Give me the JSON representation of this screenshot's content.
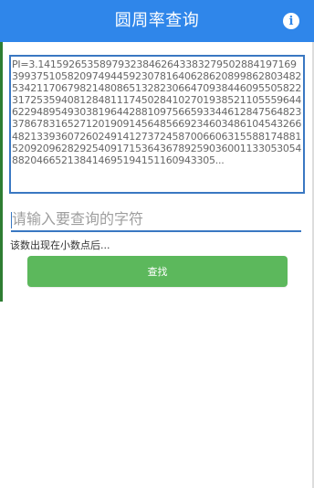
{
  "app_bar": {
    "title": "圆周率查询",
    "info_icon": "info-icon",
    "info_glyph": "i",
    "color": "#2f86ea"
  },
  "pi_display": {
    "text": "PI=3.14159265358979323846264338327950288419716939937510582097494459230781640628620899862803482534211706798214808651328230664709384460955058223172535940812848111745028410270193852110555964462294895493038196442881097566593344612847564823378678316527120190914564856692346034861045432664821339360726024914127372458700660631558817488152092096282925409171536436789259036001133053054882046652138414695194151160943305..."
  },
  "search": {
    "placeholder": "请输入要查询的字符",
    "value": ""
  },
  "result": {
    "text": "该数出现在小数点后..."
  },
  "actions": {
    "search_label": "查找",
    "button_color": "#5cb85c"
  }
}
